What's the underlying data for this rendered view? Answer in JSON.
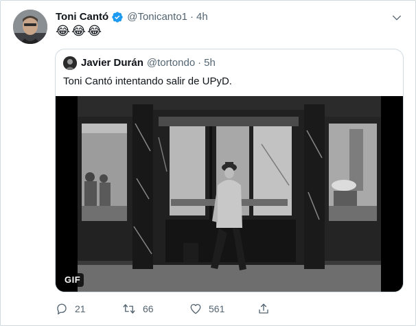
{
  "tweet": {
    "author_name": "Toni Cantó",
    "author_handle": "@Tonicanto1",
    "separator": "·",
    "time": "4h",
    "text": "😂😂😂",
    "verified": true
  },
  "quote": {
    "author_name": "Javier Durán",
    "author_handle": "@tortondo",
    "separator": "·",
    "time": "5h",
    "text": "Toni Cantó intentando salir de UPyD.",
    "media_badge": "GIF"
  },
  "actions": {
    "reply_count": "21",
    "retweet_count": "66",
    "like_count": "561"
  },
  "colors": {
    "verified": "#1d9bf0",
    "secondary_text": "#536471",
    "border": "#cfd9de"
  },
  "icons": {
    "menu": "chevron-down-icon",
    "verified": "verified-badge-icon",
    "reply": "reply-icon",
    "retweet": "retweet-icon",
    "like": "heart-icon",
    "share": "share-icon"
  }
}
